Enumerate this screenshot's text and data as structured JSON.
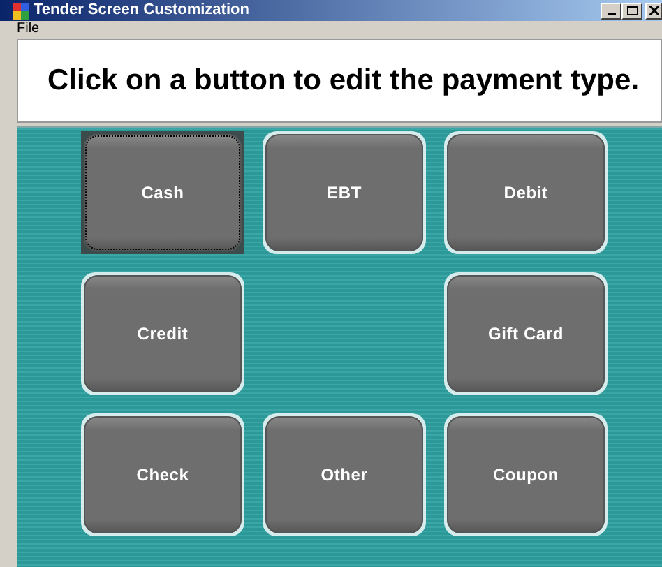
{
  "window": {
    "title": "Tender Screen Customization"
  },
  "menu": [
    "File"
  ],
  "banner": "Click on a button to edit the payment type.",
  "buttons": [
    {
      "kind": "tender",
      "label": "Cash",
      "selected": true
    },
    {
      "kind": "tender",
      "label": "EBT",
      "selected": false
    },
    {
      "kind": "tender",
      "label": "Debit",
      "selected": false
    },
    {
      "kind": "tender",
      "label": "Credit",
      "selected": false
    },
    {
      "kind": "empty"
    },
    {
      "kind": "tender",
      "label": "Gift Card",
      "selected": false
    },
    {
      "kind": "tender",
      "label": "Check",
      "selected": false
    },
    {
      "kind": "tender",
      "label": "Other",
      "selected": false
    },
    {
      "kind": "tender",
      "label": "Coupon",
      "selected": false
    }
  ]
}
